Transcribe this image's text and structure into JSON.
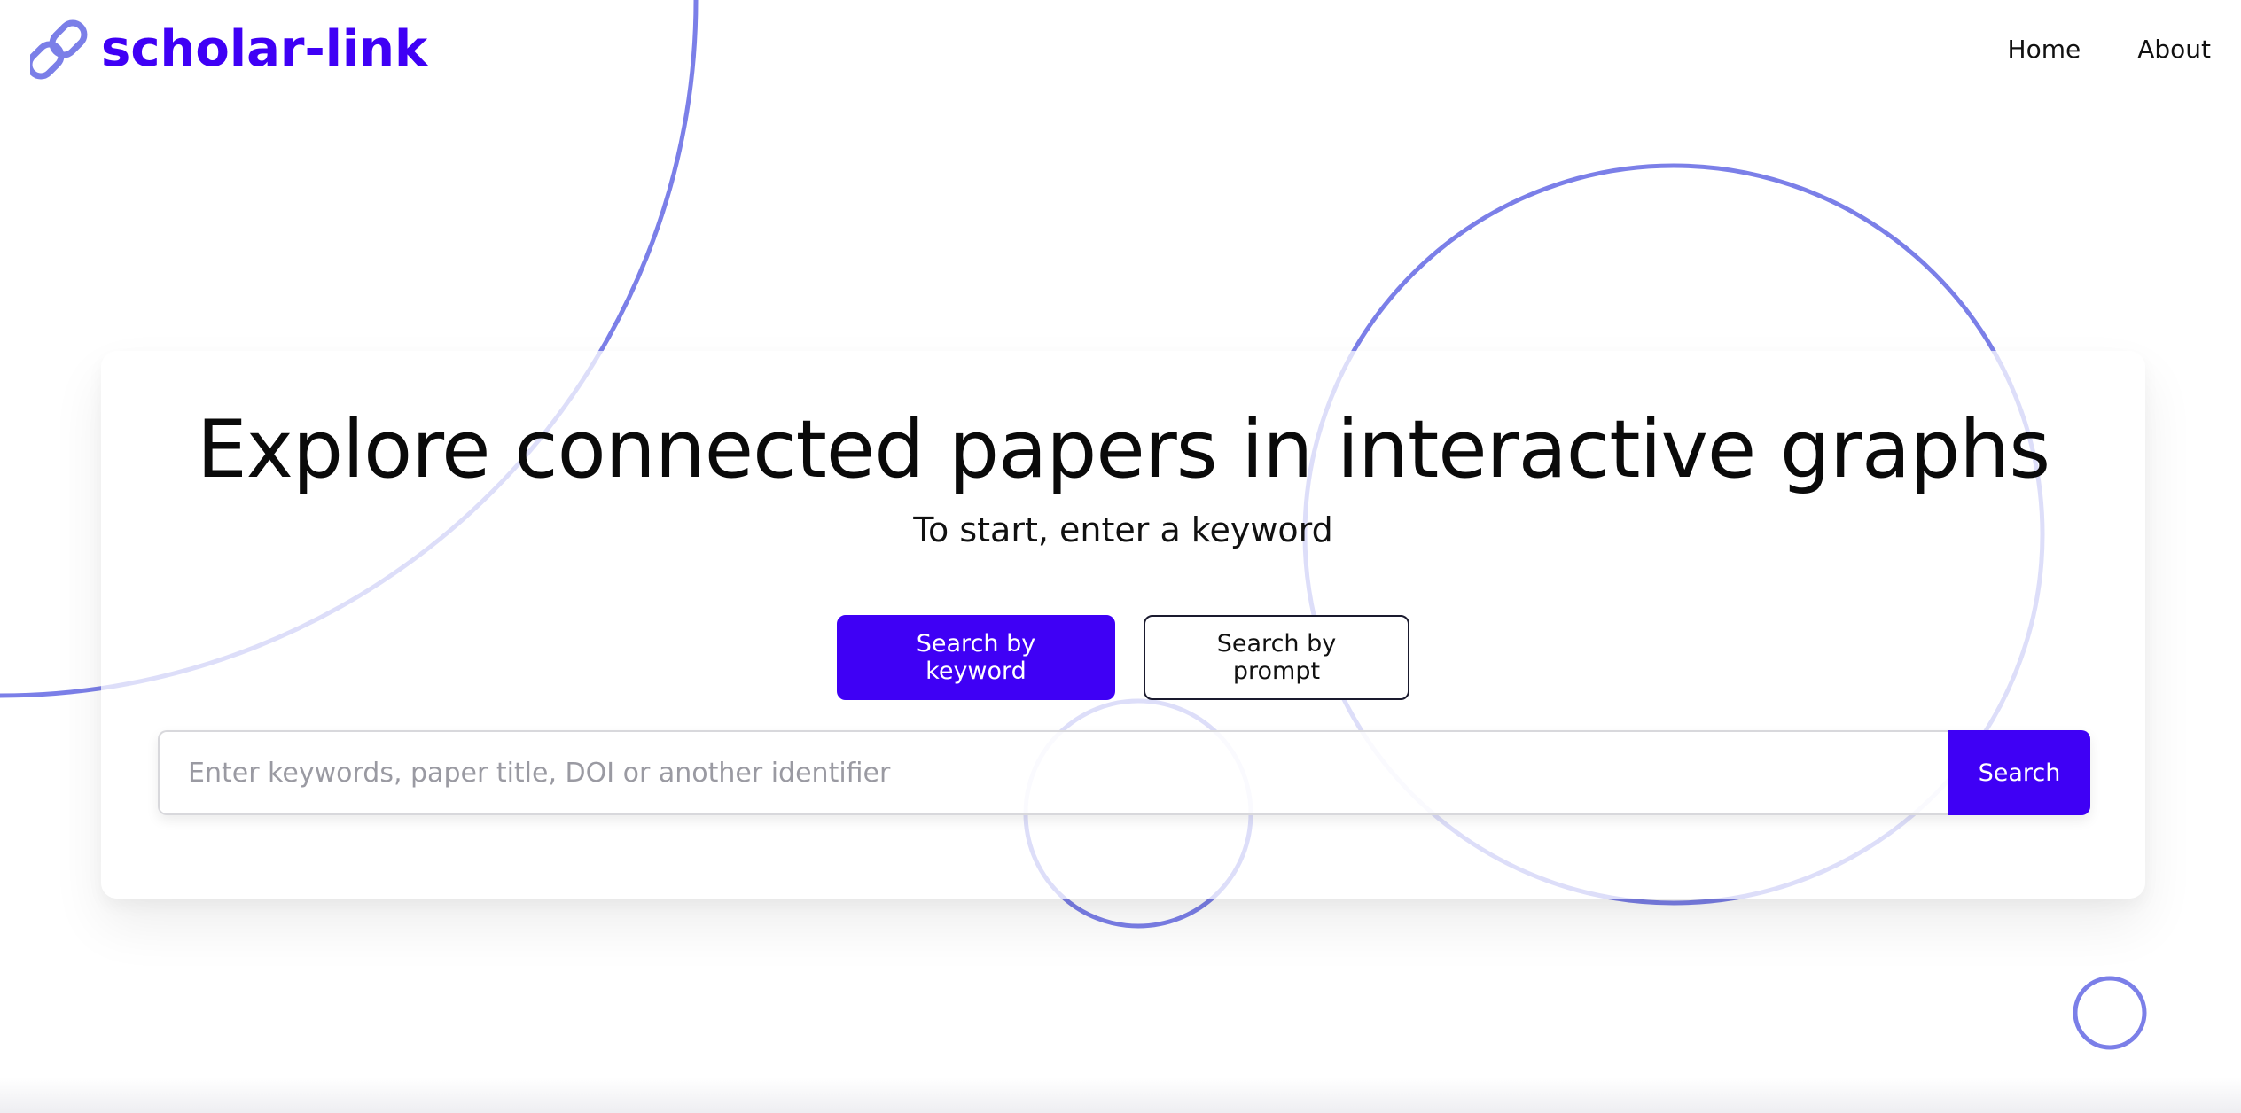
{
  "brand": {
    "name": "scholar-link",
    "color": "#3f00f5",
    "icon": "link-chain-icon"
  },
  "nav": {
    "items": [
      {
        "label": "Home"
      },
      {
        "label": "About"
      }
    ]
  },
  "hero": {
    "title": "Explore connected papers in interactive graphs",
    "subtitle": "To start, enter a keyword",
    "modes": {
      "keyword_label": "Search by keyword",
      "prompt_label": "Search by prompt",
      "selected": "keyword"
    },
    "search": {
      "placeholder": "Enter keywords, paper title, DOI or another identifier",
      "value": "",
      "button_label": "Search"
    }
  },
  "colors": {
    "accent": "#3f00f5",
    "decor_circle": "#7b7fe8"
  }
}
